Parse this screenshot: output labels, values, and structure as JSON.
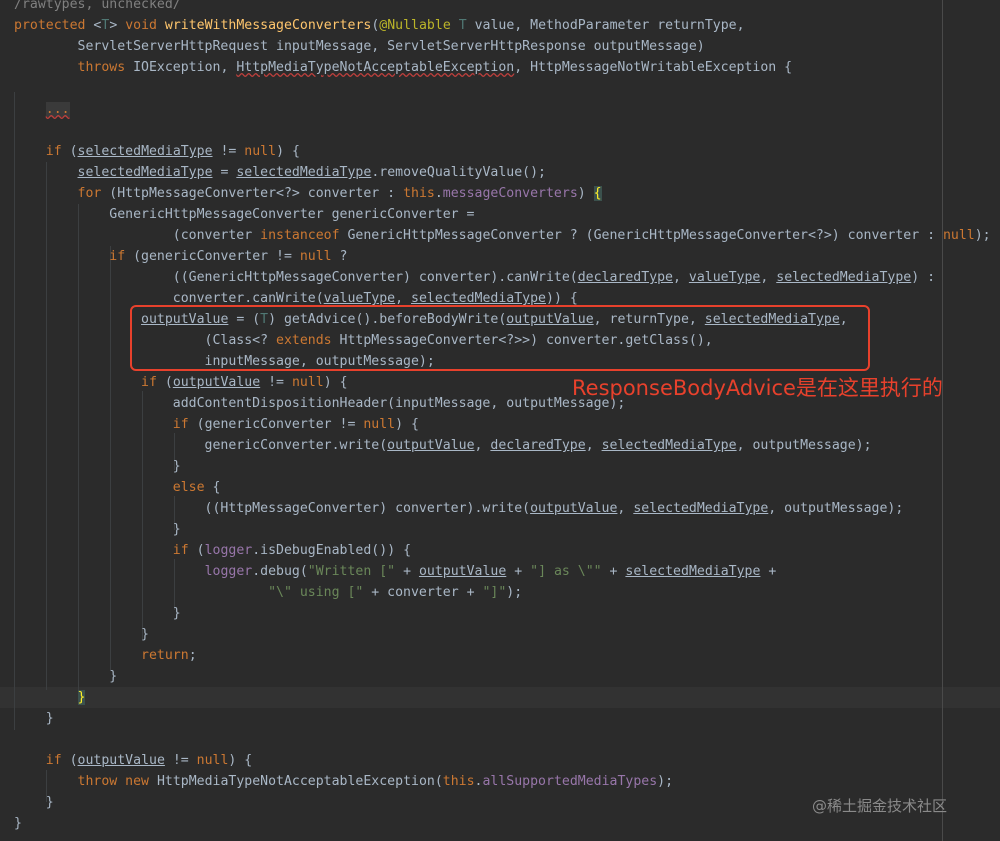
{
  "editor": {
    "lines": [
      [
        [
          "/rawtypes, unchecked/",
          "cmt"
        ]
      ],
      [
        [
          "protected ",
          "kw"
        ],
        [
          "<",
          ""
        ],
        [
          "T",
          "tp"
        ],
        [
          "> ",
          ""
        ],
        [
          "void ",
          "kw"
        ],
        [
          "writeWithMessageConverters",
          "fn"
        ],
        [
          "(",
          ""
        ],
        [
          "@Nullable ",
          "ann"
        ],
        [
          "T ",
          "tp"
        ],
        [
          "value, MethodParameter returnType,",
          ""
        ]
      ],
      [
        [
          "        ServletServerHttpRequest inputMessage, ServletServerHttpResponse outputMessage)",
          ""
        ]
      ],
      [
        [
          "        ",
          ""
        ],
        [
          "throws ",
          "kw"
        ],
        [
          "IOException, ",
          ""
        ],
        [
          "HttpMediaTypeNotAcceptableException",
          "warn"
        ],
        [
          ", HttpMessageNotWritableException {",
          ""
        ]
      ],
      [
        [
          "",
          ""
        ]
      ],
      [
        [
          "    ",
          ""
        ],
        [
          "...",
          "fold"
        ]
      ],
      [
        [
          "",
          ""
        ]
      ],
      [
        [
          "    ",
          ""
        ],
        [
          "if ",
          "kw"
        ],
        [
          "(",
          ""
        ],
        [
          "selectedMediaType",
          "u"
        ],
        [
          " != ",
          ""
        ],
        [
          "null",
          "kw"
        ],
        [
          ") {",
          ""
        ]
      ],
      [
        [
          "        ",
          ""
        ],
        [
          "selectedMediaType",
          "u"
        ],
        [
          " = ",
          ""
        ],
        [
          "selectedMediaType",
          "u"
        ],
        [
          ".removeQualityValue();",
          ""
        ]
      ],
      [
        [
          "        ",
          ""
        ],
        [
          "for ",
          "kw"
        ],
        [
          "(HttpMessageConverter<?> converter : ",
          ""
        ],
        [
          "this",
          "kw"
        ],
        [
          ".",
          ""
        ],
        [
          "messageConverters",
          "fld"
        ],
        [
          ") ",
          ""
        ],
        [
          "{",
          "bh"
        ]
      ],
      [
        [
          "            GenericHttpMessageConverter genericConverter =",
          ""
        ]
      ],
      [
        [
          "                    (converter ",
          ""
        ],
        [
          "instanceof ",
          "kw"
        ],
        [
          "GenericHttpMessageConverter ? (GenericHttpMessageConverter<?>) converter : ",
          ""
        ],
        [
          "null",
          "kw"
        ],
        [
          ");",
          ""
        ]
      ],
      [
        [
          "            ",
          ""
        ],
        [
          "if ",
          "kw"
        ],
        [
          "(genericConverter != ",
          ""
        ],
        [
          "null ",
          "kw"
        ],
        [
          "?",
          ""
        ]
      ],
      [
        [
          "                    ((GenericHttpMessageConverter) converter).canWrite(",
          ""
        ],
        [
          "declaredType",
          "u"
        ],
        [
          ", ",
          ""
        ],
        [
          "valueType",
          "u"
        ],
        [
          ", ",
          ""
        ],
        [
          "selectedMediaType",
          "u"
        ],
        [
          ") :",
          ""
        ]
      ],
      [
        [
          "                    converter.canWrite(",
          ""
        ],
        [
          "valueType",
          "u"
        ],
        [
          ", ",
          ""
        ],
        [
          "selectedMediaType",
          "u"
        ],
        [
          ")) {",
          ""
        ]
      ],
      [
        [
          "                ",
          ""
        ],
        [
          "outputValue",
          "u"
        ],
        [
          " = (",
          ""
        ],
        [
          "T",
          "tp"
        ],
        [
          ") getAdvice().beforeBodyWrite(",
          ""
        ],
        [
          "outputValue",
          "u"
        ],
        [
          ", returnType, ",
          ""
        ],
        [
          "selectedMediaType",
          "u"
        ],
        [
          ",",
          ""
        ]
      ],
      [
        [
          "                        (Class<? ",
          ""
        ],
        [
          "extends ",
          "kw"
        ],
        [
          "HttpMessageConverter<?>>) converter.getClass(),",
          ""
        ]
      ],
      [
        [
          "                        inputMessage, outputMessage);",
          ""
        ]
      ],
      [
        [
          "                ",
          ""
        ],
        [
          "if ",
          "kw"
        ],
        [
          "(",
          ""
        ],
        [
          "outputValue",
          "u"
        ],
        [
          " != ",
          ""
        ],
        [
          "null",
          "kw"
        ],
        [
          ") {",
          ""
        ]
      ],
      [
        [
          "                    addContentDispositionHeader(inputMessage, outputMessage);",
          ""
        ]
      ],
      [
        [
          "                    ",
          ""
        ],
        [
          "if ",
          "kw"
        ],
        [
          "(genericConverter != ",
          ""
        ],
        [
          "null",
          "kw"
        ],
        [
          ") {",
          ""
        ]
      ],
      [
        [
          "                        genericConverter.write(",
          ""
        ],
        [
          "outputValue",
          "u"
        ],
        [
          ", ",
          ""
        ],
        [
          "declaredType",
          "u"
        ],
        [
          ", ",
          ""
        ],
        [
          "selectedMediaType",
          "u"
        ],
        [
          ", outputMessage);",
          ""
        ]
      ],
      [
        [
          "                    }",
          ""
        ]
      ],
      [
        [
          "                    ",
          ""
        ],
        [
          "else ",
          "kw"
        ],
        [
          "{",
          ""
        ]
      ],
      [
        [
          "                        ((HttpMessageConverter) converter).write(",
          ""
        ],
        [
          "outputValue",
          "u"
        ],
        [
          ", ",
          ""
        ],
        [
          "selectedMediaType",
          "u"
        ],
        [
          ", outputMessage);",
          ""
        ]
      ],
      [
        [
          "                    }",
          ""
        ]
      ],
      [
        [
          "                    ",
          ""
        ],
        [
          "if ",
          "kw"
        ],
        [
          "(",
          ""
        ],
        [
          "logger",
          "fld"
        ],
        [
          ".isDebugEnabled()) {",
          ""
        ]
      ],
      [
        [
          "                        ",
          ""
        ],
        [
          "logger",
          "fld"
        ],
        [
          ".debug(",
          ""
        ],
        [
          "\"Written [\"",
          "str"
        ],
        [
          " + ",
          ""
        ],
        [
          "outputValue",
          "u"
        ],
        [
          " + ",
          ""
        ],
        [
          "\"] as \\\"\"",
          "str"
        ],
        [
          " + ",
          ""
        ],
        [
          "selectedMediaType",
          "u"
        ],
        [
          " +",
          ""
        ]
      ],
      [
        [
          "                                ",
          ""
        ],
        [
          "\"\\\" using [\"",
          "str"
        ],
        [
          " + converter + ",
          ""
        ],
        [
          "\"]\"",
          "str"
        ],
        [
          ");",
          ""
        ]
      ],
      [
        [
          "                    }",
          ""
        ]
      ],
      [
        [
          "                }",
          ""
        ]
      ],
      [
        [
          "                ",
          ""
        ],
        [
          "return",
          "kw"
        ],
        [
          ";",
          ""
        ]
      ],
      [
        [
          "            }",
          ""
        ]
      ],
      [
        [
          "        ",
          ""
        ],
        [
          "}",
          "bh"
        ]
      ],
      [
        [
          "    }",
          ""
        ]
      ],
      [
        [
          "",
          ""
        ]
      ],
      [
        [
          "    ",
          ""
        ],
        [
          "if ",
          "kw"
        ],
        [
          "(",
          ""
        ],
        [
          "outputValue",
          "u"
        ],
        [
          " != ",
          ""
        ],
        [
          "null",
          "kw"
        ],
        [
          ") {",
          ""
        ]
      ],
      [
        [
          "        ",
          ""
        ],
        [
          "throw ",
          "kw"
        ],
        [
          "new ",
          "kw"
        ],
        [
          "HttpMediaTypeNotAcceptableException(",
          ""
        ],
        [
          "this",
          "kw"
        ],
        [
          ".",
          ""
        ],
        [
          "allSupportedMediaTypes",
          "fld"
        ],
        [
          ");",
          ""
        ]
      ],
      [
        [
          "    }",
          ""
        ]
      ],
      [
        [
          "}",
          ""
        ]
      ]
    ]
  },
  "annotation": {
    "text": "ResponseBodyAdvice是在这里执行的",
    "color": "#e8412c"
  },
  "watermark": {
    "text": "@稀土掘金技术社区"
  }
}
